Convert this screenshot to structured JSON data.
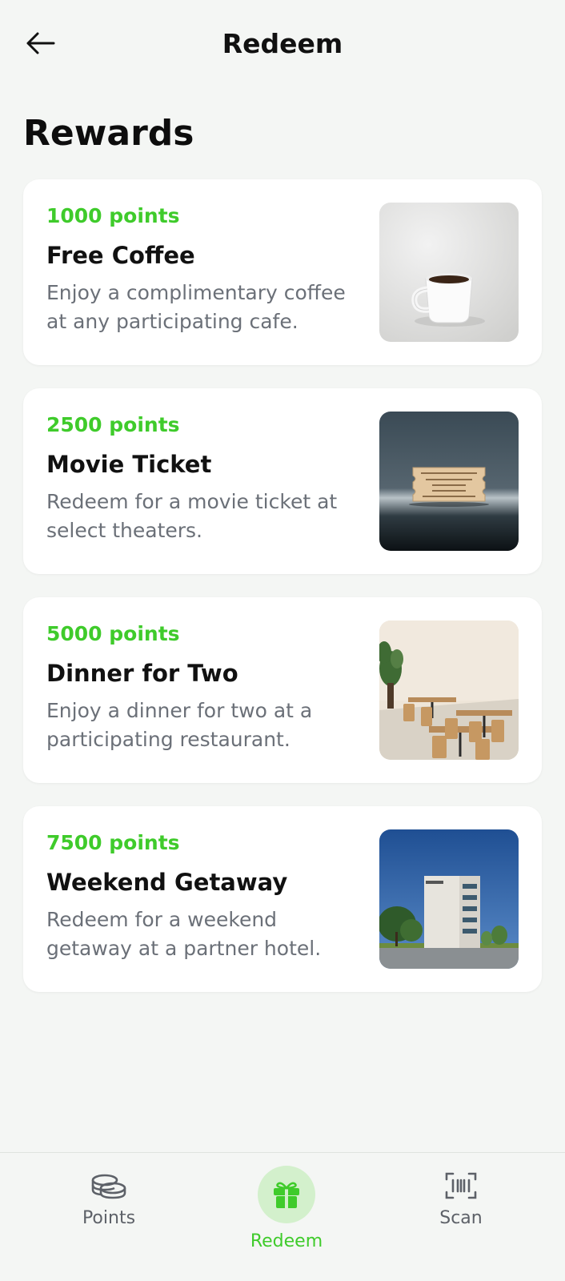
{
  "header": {
    "title": "Redeem",
    "back_icon": "arrow-left-icon"
  },
  "section_title": "Rewards",
  "rewards": [
    {
      "points": "1000 points",
      "title": "Free Coffee",
      "description": "Enjoy a complimentary coffee at any participating cafe.",
      "image": "coffee-cup-image"
    },
    {
      "points": "2500 points",
      "title": "Movie Ticket",
      "description": "Redeem for a movie ticket at select theaters.",
      "image": "movie-ticket-image"
    },
    {
      "points": "5000 points",
      "title": "Dinner for Two",
      "description": "Enjoy a dinner for two at a participating restaurant.",
      "image": "restaurant-image"
    },
    {
      "points": "7500 points",
      "title": "Weekend Getaway",
      "description": "Redeem for a weekend getaway at a partner hotel.",
      "image": "hotel-image"
    }
  ],
  "bottom_nav": {
    "items": [
      {
        "label": "Points",
        "icon": "coins-icon",
        "active": false
      },
      {
        "label": "Redeem",
        "icon": "gift-icon",
        "active": true
      },
      {
        "label": "Scan",
        "icon": "barcode-scan-icon",
        "active": false
      }
    ]
  },
  "colors": {
    "accent": "#3fcb2b",
    "accent_bg": "#d3f0cc",
    "background": "#f4f6f4",
    "card": "#ffffff",
    "muted_text": "#6b7078"
  }
}
